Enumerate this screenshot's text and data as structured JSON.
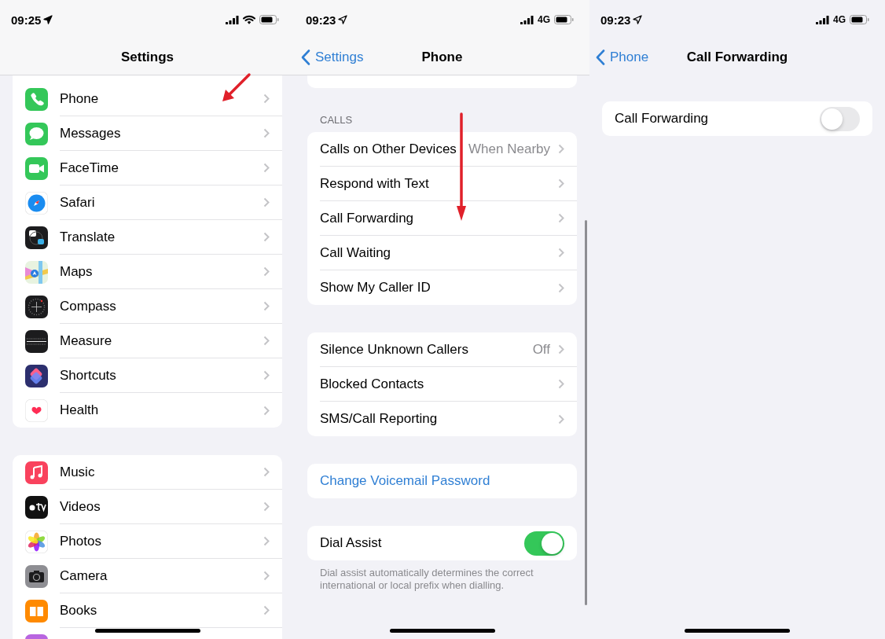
{
  "screens": [
    {
      "status_bar": {
        "time": "09:25",
        "kind": "wifi"
      },
      "nav": {
        "title": "Settings"
      },
      "arrow": true,
      "groups": [
        {
          "kind": "list",
          "cut_top": true,
          "rows": [
            {
              "label": "Phone",
              "color": "#34c759"
            },
            {
              "label": "Messages",
              "color": "#34c759"
            },
            {
              "label": "FaceTime",
              "color": "#34c759"
            },
            {
              "label": "Safari",
              "color": "#ffffff"
            },
            {
              "label": "Translate",
              "color": "#1c1c1e"
            },
            {
              "label": "Maps",
              "color": "#e8f3e0"
            },
            {
              "label": "Compass",
              "color": "#1c1c1e"
            },
            {
              "label": "Measure",
              "color": "#1c1c1e"
            },
            {
              "label": "Shortcuts",
              "color": "#2c2f6e"
            },
            {
              "label": "Health",
              "color": "#ffffff"
            }
          ]
        },
        {
          "kind": "list",
          "rows": [
            {
              "label": "Music",
              "color": "#f9425d"
            },
            {
              "label": "Videos",
              "color": "#111111"
            },
            {
              "label": "Photos",
              "color": "#ffffff"
            },
            {
              "label": "Camera",
              "color": "#8e8e93"
            },
            {
              "label": "Books",
              "color": "#ff8a00"
            },
            {
              "color": "#b865e0"
            }
          ]
        }
      ]
    },
    {
      "status_bar": {
        "time": "09:23",
        "kind": "cellular",
        "network": "4G"
      },
      "nav": {
        "title": "Phone",
        "back": "Settings"
      },
      "arrow": true,
      "scroll_bar": true,
      "groups": [
        {
          "kind": "cut"
        },
        {
          "kind": "list",
          "header": "CALLS",
          "rows": [
            {
              "kind": "nav",
              "label": "Calls on Other Devices",
              "value": "When Nearby"
            },
            {
              "kind": "nav",
              "label": "Respond with Text"
            },
            {
              "kind": "nav",
              "label": "Call Forwarding"
            },
            {
              "kind": "nav",
              "label": "Call Waiting"
            },
            {
              "kind": "nav",
              "label": "Show My Caller ID"
            }
          ]
        },
        {
          "kind": "list",
          "rows": [
            {
              "kind": "nav",
              "label": "Silence Unknown Callers",
              "value": "Off"
            },
            {
              "kind": "nav",
              "label": "Blocked Contacts"
            },
            {
              "kind": "nav",
              "label": "SMS/Call Reporting"
            }
          ]
        },
        {
          "kind": "list",
          "rows": [
            {
              "kind": "link",
              "label": "Change Voicemail Password"
            }
          ]
        },
        {
          "kind": "list",
          "footer": "Dial assist automatically determines the correct international or local prefix when dialling.",
          "rows": [
            {
              "kind": "toggle",
              "label": "Dial Assist",
              "on": true
            }
          ]
        }
      ]
    },
    {
      "status_bar": {
        "time": "09:23",
        "kind": "cellular",
        "network": "4G"
      },
      "nav": {
        "title": "Call Forwarding",
        "back": "Phone"
      },
      "groups": [
        {
          "kind": "list",
          "rows": [
            {
              "kind": "toggle",
              "label": "Call Forwarding",
              "on": false
            }
          ]
        }
      ]
    }
  ]
}
